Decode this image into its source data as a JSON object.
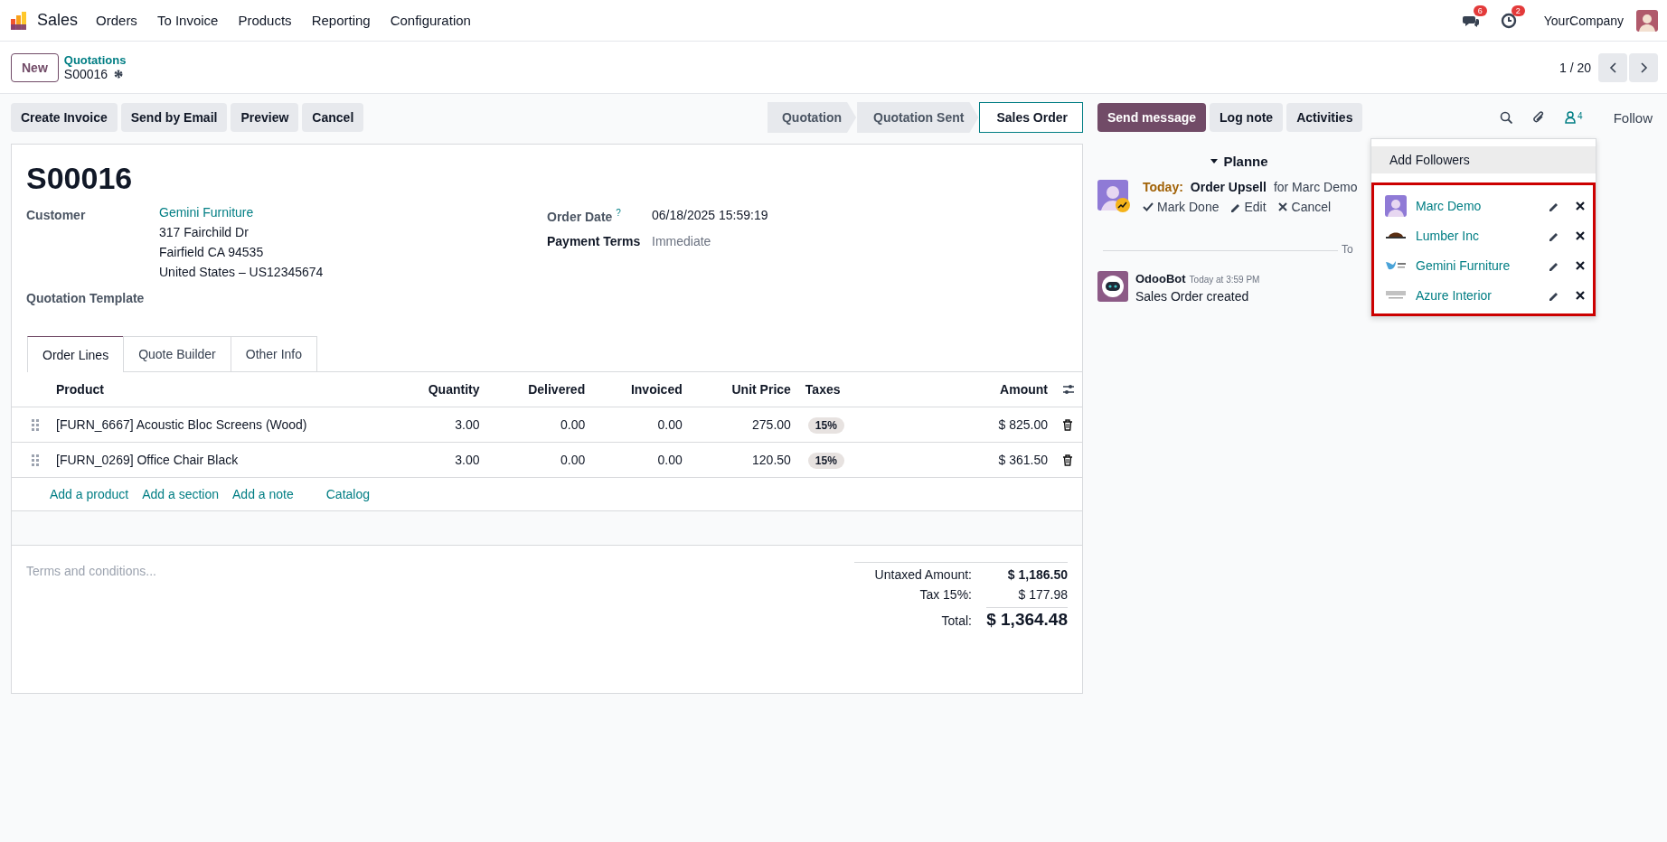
{
  "navbar": {
    "app_name": "Sales",
    "menus": [
      "Orders",
      "To Invoice",
      "Products",
      "Reporting",
      "Configuration"
    ],
    "messages_badge": "6",
    "activities_badge": "2",
    "company": "YourCompany"
  },
  "control_panel": {
    "new_button": "New",
    "breadcrumb": "Quotations",
    "record": "S00016",
    "pager": "1 / 20"
  },
  "actions": [
    "Create Invoice",
    "Send by Email",
    "Preview",
    "Cancel"
  ],
  "statusbar": [
    {
      "label": "Quotation",
      "selected": false
    },
    {
      "label": "Quotation Sent",
      "selected": false
    },
    {
      "label": "Sales Order",
      "selected": true
    }
  ],
  "form": {
    "title": "S00016",
    "customer_label": "Customer",
    "customer": "Gemini Furniture",
    "address": [
      "317 Fairchild Dr",
      "Fairfield CA 94535",
      "United States – US12345674"
    ],
    "template_label": "Quotation Template",
    "order_date_label": "Order Date",
    "order_date_help": "?",
    "order_date": "06/18/2025 15:59:19",
    "payment_terms_label": "Payment Terms",
    "payment_terms": "Immediate"
  },
  "tabs": [
    {
      "label": "Order Lines",
      "selected": true
    },
    {
      "label": "Quote Builder",
      "selected": false
    },
    {
      "label": "Other Info",
      "selected": false
    }
  ],
  "lines": {
    "columns": [
      "Product",
      "Quantity",
      "Delivered",
      "Invoiced",
      "Unit Price",
      "Taxes",
      "Amount"
    ],
    "rows": [
      {
        "product": "[FURN_6667] Acoustic Bloc Screens (Wood)",
        "quantity": "3.00",
        "delivered": "0.00",
        "invoiced": "0.00",
        "unit_price": "275.00",
        "tax": "15%",
        "amount": "$ 825.00"
      },
      {
        "product": "[FURN_0269] Office Chair Black",
        "quantity": "3.00",
        "delivered": "0.00",
        "invoiced": "0.00",
        "unit_price": "120.50",
        "tax": "15%",
        "amount": "$ 361.50"
      }
    ],
    "add_links": [
      "Add a product",
      "Add a section",
      "Add a note",
      "Catalog"
    ]
  },
  "terms": {
    "placeholder": "Terms and conditions..."
  },
  "totals": [
    {
      "label": "Untaxed Amount:",
      "value": "$ 1,186.50",
      "kind": "subtotal"
    },
    {
      "label": "Tax 15%:",
      "value": "$ 177.98",
      "kind": "tax"
    },
    {
      "label": "Total:",
      "value": "$ 1,364.48",
      "kind": "total"
    }
  ],
  "chatter": {
    "buttons": [
      {
        "label": "Send message",
        "kind": "primary"
      },
      {
        "label": "Log note",
        "kind": "secondary"
      },
      {
        "label": "Activities",
        "kind": "secondary"
      }
    ],
    "followers_count": "4",
    "follow": "Follow",
    "planned_heading": "Planne",
    "activity": {
      "day": "Today:",
      "title": "Order Upsell",
      "assignee": "for Marc Demo",
      "actions": [
        "Mark Done",
        "Edit",
        "Cancel"
      ]
    },
    "date_divider": "To",
    "message": {
      "author": "OdooBot",
      "time": "Today at 3:59 PM",
      "body": "Sales Order created"
    }
  },
  "followers_dropdown": {
    "add": "Add Followers",
    "followers": [
      {
        "name": "Marc Demo",
        "kind": "person"
      },
      {
        "name": "Lumber Inc",
        "kind": "lumber"
      },
      {
        "name": "Gemini Furniture",
        "kind": "gemini"
      },
      {
        "name": "Azure Interior",
        "kind": "azure"
      }
    ]
  }
}
